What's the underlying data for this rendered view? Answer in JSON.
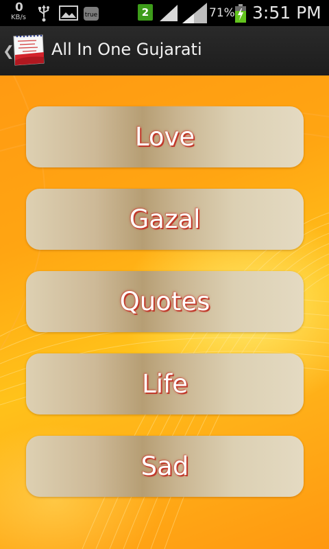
{
  "status_bar": {
    "net_speed_value": "0",
    "net_speed_unit": "KB/s",
    "notif_true_label": "true",
    "sim_badge": "2",
    "battery_percent": "71%",
    "time": "3:51 PM",
    "icons": [
      "usb-icon",
      "gallery-icon",
      "true-app-icon",
      "signal-icon",
      "signal-icon",
      "battery-charging-icon"
    ]
  },
  "action_bar": {
    "title": "All In One Gujarati",
    "up_icon": "chevron-left-icon",
    "app_icon": "calendar-app-icon"
  },
  "menu": {
    "items": [
      {
        "label": "Love"
      },
      {
        "label": "Gazal"
      },
      {
        "label": "Quotes"
      },
      {
        "label": "Life"
      },
      {
        "label": "Sad"
      }
    ]
  },
  "colors": {
    "background_orange": "#ff9a12",
    "background_yellow": "#ffd21f",
    "button_beige": "#ddd0b2",
    "label_shadow_red": "#c0392b",
    "action_bar": "#262626"
  }
}
